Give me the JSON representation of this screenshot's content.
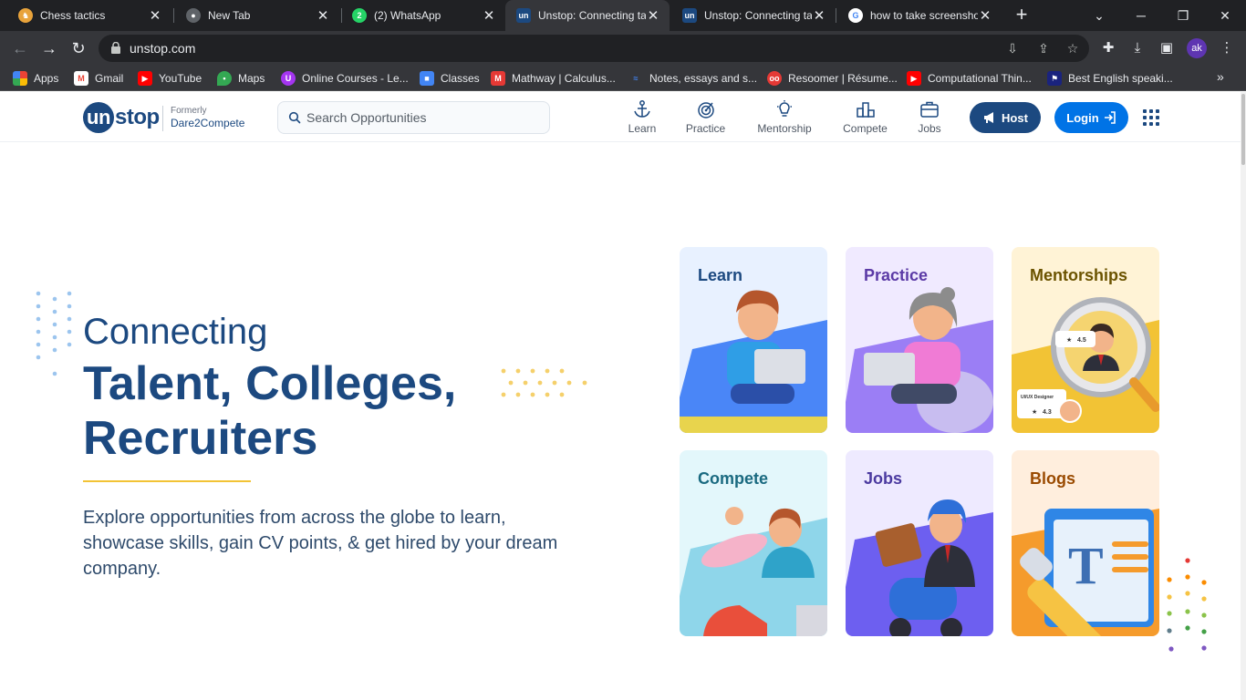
{
  "browser": {
    "tabs": [
      {
        "title": "Chess tactics",
        "favicon": "chess-icon",
        "active": false
      },
      {
        "title": "New Tab",
        "favicon": "chrome-icon",
        "active": false
      },
      {
        "title": "(2) WhatsApp",
        "favicon": "whatsapp-icon",
        "badge": "2",
        "active": false
      },
      {
        "title": "Unstop: Connecting ta",
        "favicon": "unstop-icon",
        "active": true
      },
      {
        "title": "Unstop: Connecting ta",
        "favicon": "unstop-icon",
        "active": false
      },
      {
        "title": "how to take screensho",
        "favicon": "google-icon",
        "active": false
      }
    ],
    "url": "unstop.com",
    "profile_initials": "ak",
    "bookmarks": [
      {
        "label": "Apps",
        "icon": "apps-grid-icon"
      },
      {
        "label": "Gmail",
        "icon": "gmail-icon"
      },
      {
        "label": "YouTube",
        "icon": "youtube-icon"
      },
      {
        "label": "Maps",
        "icon": "maps-icon"
      },
      {
        "label": "Online Courses - Le...",
        "icon": "udemy-icon"
      },
      {
        "label": "Classes",
        "icon": "classroom-icon"
      },
      {
        "label": "Mathway | Calculus...",
        "icon": "mathway-icon"
      },
      {
        "label": "Notes, essays and s...",
        "icon": "notes-icon"
      },
      {
        "label": "Resoomer | Résume...",
        "icon": "resoomer-icon"
      },
      {
        "label": "Computational Thin...",
        "icon": "youtube-icon"
      },
      {
        "label": "Best English speaki...",
        "icon": "flag-icon"
      }
    ]
  },
  "header": {
    "logo_un": "un",
    "logo_rest": "stop",
    "formerly_label": "Formerly",
    "formerly_name": "Dare2Compete",
    "search_placeholder": "Search Opportunities",
    "nav": [
      {
        "label": "Learn",
        "icon": "anchor-icon"
      },
      {
        "label": "Practice",
        "icon": "target-icon"
      },
      {
        "label": "Mentorship",
        "icon": "lightbulb-icon"
      },
      {
        "label": "Compete",
        "icon": "podium-icon"
      },
      {
        "label": "Jobs",
        "icon": "briefcase-icon"
      }
    ],
    "host_label": "Host",
    "login_label": "Login"
  },
  "hero": {
    "title_line1": "Connecting",
    "title_line2": "Talent, Colleges, Recruiters",
    "description": "Explore opportunities from across the globe to learn, showcase skills, gain CV points, & get hired by your dream company."
  },
  "cards": [
    {
      "title": "Learn",
      "bg": "#e8f1ff",
      "title_color": "#1c4980"
    },
    {
      "title": "Practice",
      "bg": "#f0eaff",
      "title_color": "#5b3aa6"
    },
    {
      "title": "Mentorships",
      "bg": "#fff3d6",
      "title_color": "#6b5300",
      "rating1": "4.5",
      "rating2": "4.3",
      "tag": "UI/UX Designer"
    },
    {
      "title": "Compete",
      "bg": "#e3f7fb",
      "title_color": "#1a6a80"
    },
    {
      "title": "Jobs",
      "bg": "#eeeaff",
      "title_color": "#4b3aa0"
    },
    {
      "title": "Blogs",
      "bg": "#ffeedd",
      "title_color": "#9a4a00"
    }
  ],
  "colors": {
    "brand_navy": "#1c4980",
    "brand_blue": "#0073e6",
    "accent_yellow": "#f2c335"
  }
}
